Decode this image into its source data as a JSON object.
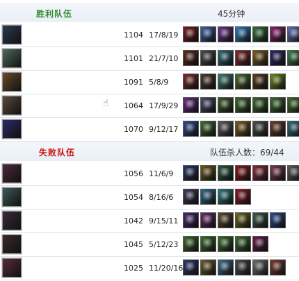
{
  "header": {
    "win_title": "胜利队伍",
    "duration": "45分钟",
    "lose_title": "失败队伍",
    "kills": "队伍杀人数：69/44"
  },
  "win_rows": [
    {
      "num": "1104",
      "kda": "17/8/19",
      "avatar": "#2a3b52",
      "items": [
        "#7a1c1c",
        "#3b5fa8",
        "#6b2f8a",
        "#2c7fb8",
        "#2f6f3b",
        "#8a1f6e",
        "#5c6fb0"
      ]
    },
    {
      "num": "1101",
      "kda": "21/7/10",
      "avatar": "#4f6a5a",
      "items": [
        "#5b2a1a",
        "#4b4b4b",
        "#2e6a7a",
        "#8a2a2a",
        "#7a5a1a",
        "#2a2a6a",
        "#3d7d4a"
      ]
    },
    {
      "num": "1091",
      "kda": "5/8/9",
      "avatar": "#6a4a2a",
      "items": [
        "#7a2a2a",
        "#4a3a2a",
        "#3a7a6a",
        "#4a6a2a",
        "#5a3a1a",
        "#6a8a1a"
      ]
    },
    {
      "num": "1064",
      "kda": "17/9/29",
      "avatar": "#5a4a3a",
      "items": [
        "#6a2a8a",
        "#4a4a6a",
        "#3a5a2a",
        "#3a6a2a",
        "#3a6a2a",
        "#3a6a2a",
        "#3a6a2a"
      ]
    },
    {
      "num": "1070",
      "kda": "9/12/17",
      "avatar": "#2a2a6a",
      "items": [
        "#2a4a8a",
        "#3a6a2a",
        "#5a5a5a",
        "#7a5a1a",
        "#4a4a4a",
        "#6a3a2a",
        "#2a6a7a"
      ]
    }
  ],
  "lose_rows": [
    {
      "num": "1056",
      "kda": "11/6/9",
      "avatar": "#4a2a3a",
      "items": [
        "#2a3a6a",
        "#6a5a1a",
        "#2a5a3a",
        "#8a1a1a",
        "#8a2a3a",
        "#7a3a4a",
        "#5a5a5a"
      ]
    },
    {
      "num": "1054",
      "kda": "8/16/6",
      "avatar": "#3a5a5a",
      "items": [
        "#3a3a5a",
        "#2a6a8a",
        "#2a7a7a",
        "#8a1a2a"
      ]
    },
    {
      "num": "1042",
      "kda": "9/15/11",
      "avatar": "#3a2a3a",
      "items": [
        "#4a2a6a",
        "#6a2a6a",
        "#5a4a2a",
        "#6a6a1a",
        "#3a5a4a",
        "#2a4a8a"
      ]
    },
    {
      "num": "1045",
      "kda": "5/12/23",
      "avatar": "#3a2a2a",
      "items": [
        "#3a6a2a",
        "#3a6a2a",
        "#3a6a2a",
        "#3a6a2a",
        "#6a1a4a"
      ]
    },
    {
      "num": "1025",
      "kda": "11/20/16",
      "avatar": "#5a2a3a",
      "items": [
        "#2a3a6a",
        "#6a5a2a",
        "#3a6a8a",
        "#4a4a4a",
        "#6a6a6a",
        "#7a3a2a"
      ]
    }
  ]
}
